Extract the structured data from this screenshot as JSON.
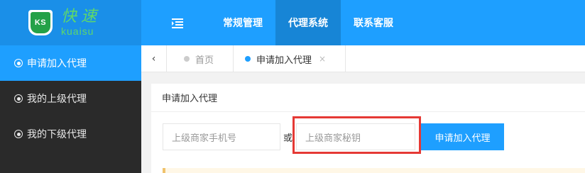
{
  "logo": {
    "badge": "KS",
    "cn": "快速",
    "en": "kuaisu"
  },
  "topnav": {
    "toggle_icon": "menu-indent-icon",
    "items": [
      {
        "label": "常规管理",
        "active": false
      },
      {
        "label": "代理系统",
        "active": true
      },
      {
        "label": "联系客服",
        "active": false
      }
    ]
  },
  "sidebar": {
    "items": [
      {
        "label": "申请加入代理",
        "active": true
      },
      {
        "label": "我的上级代理",
        "active": false
      },
      {
        "label": "我的下级代理",
        "active": false
      }
    ]
  },
  "tabs": {
    "prev_icon": "‹",
    "home": "首页",
    "apply": "申请加入代理",
    "close": "×"
  },
  "form": {
    "title": "申请加入代理",
    "phone_placeholder": "上级商家手机号",
    "or_text": "或",
    "secret_placeholder": "上级商家秘钥",
    "submit_label": "申请加入代理"
  },
  "colors": {
    "primary": "#1e9fff",
    "sidebar_bg": "#2a2a2a",
    "highlight": "#e53935",
    "logo_green": "#24a148"
  }
}
